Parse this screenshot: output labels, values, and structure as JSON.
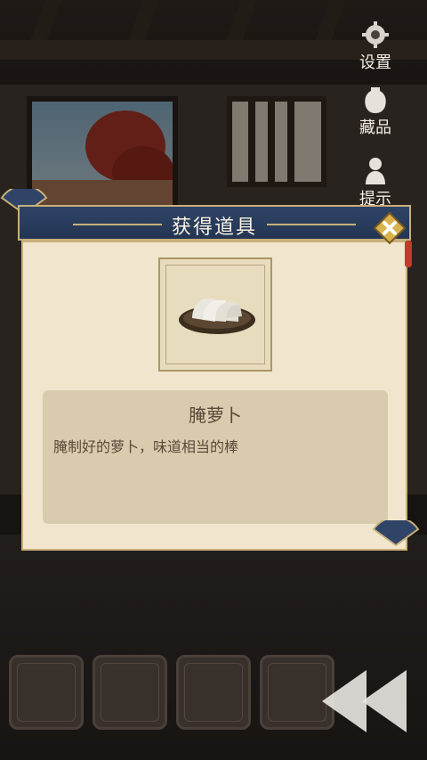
{
  "side_menu": {
    "settings_label": "设置",
    "collection_label": "藏品",
    "hint_label": "提示"
  },
  "dialog": {
    "title": "获得道具",
    "item_name": "腌萝卜",
    "item_description": "腌制好的萝卜，味道相当的棒"
  },
  "icons": {
    "settings": "gear-icon",
    "collection": "vase-icon",
    "hint": "person-hint-icon",
    "close": "close-icon",
    "item": "pickled-radish-icon"
  },
  "colors": {
    "header_blue": "#2f4466",
    "gold_border": "#c8b07a",
    "parchment": "#f1e6cd",
    "text_brown": "#5a4a3a"
  }
}
